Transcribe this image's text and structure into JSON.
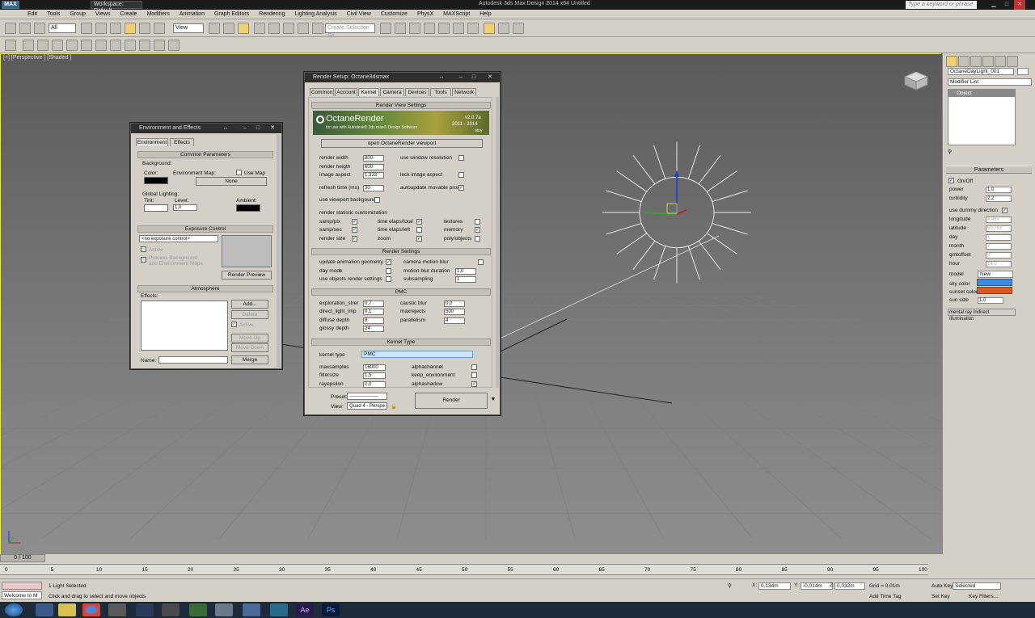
{
  "titlebar": {
    "logo": "MAX",
    "workspace": "Workspace: Default",
    "title": "Autodesk 3ds Max Design 2014 x64     Untitled",
    "search_placeholder": "Type a keyword or phrase"
  },
  "menu": [
    "Edit",
    "Tools",
    "Group",
    "Views",
    "Create",
    "Modifiers",
    "Animation",
    "Graph Editors",
    "Rendering",
    "Lighting Analysis",
    "Civil View",
    "Customize",
    "PhysX",
    "MAXScript",
    "Help"
  ],
  "toolbar": {
    "filter": "All",
    "coord": "View",
    "selection_set": "Create Selection Se"
  },
  "viewport": {
    "label": "[+] [Perspective ] [Shaded ]"
  },
  "env": {
    "title": "Environment and Effects",
    "tabs": [
      "Environment",
      "Effects"
    ],
    "common": "Common Parameters",
    "background": "Background:",
    "color": "Color:",
    "env_map": "Environment Map:",
    "use_map": "Use Map",
    "none": "None",
    "global": "Global Lighting:",
    "tint": "Tint:",
    "level": "Level:",
    "level_val": "1,0",
    "ambient": "Ambient:",
    "exposure": "Exposure Control",
    "exposure_val": "<no exposure control>",
    "active": "Active",
    "process": "Process Background\nand Environment Maps",
    "preview": "Render Preview",
    "atmos": "Atmosphere",
    "effects": "Effects:",
    "add": "Add...",
    "delete": "Delete",
    "active2": "Active",
    "move_up": "Move Up",
    "move_down": "Move Down",
    "name": "Name:",
    "merge": "Merge"
  },
  "render": {
    "title": "Render Setup: Octane3dsmax",
    "tabs": [
      "Common",
      "Account",
      "Kernel",
      "Camera",
      "Devices",
      "Tools",
      "Network"
    ],
    "sec_view": "Render View Settings",
    "banner": {
      "name": "OctaneRender",
      "sub": "for use with Autodesk® 3ds max® Design Software",
      "version": "v2.0.7a",
      "years": "2011 - 2014",
      "brand": "otoy"
    },
    "open_vp": "open OctaneRender viewport",
    "width": "render width",
    "width_val": "800",
    "height": "render heigth",
    "height_val": "600",
    "aspect": "image aspect",
    "aspect_val": "1,333",
    "use_win": "use window resolution",
    "lock_aspect": "lock image aspect",
    "refresh": "refresh time (ms)",
    "refresh_val": "30",
    "autoupdate": "autoupdate movable proxy",
    "use_bg": "use viewport backgound",
    "stats": "render statistic customization",
    "stat_items": [
      "samp/pix",
      "time elaps/total",
      "textures",
      "samp/sec",
      "time elaps/left",
      "memory",
      "render size",
      "zoom",
      "poly/objects"
    ],
    "sec_settings": "Render Settings",
    "update_geom": "update animation geometry",
    "cam_blur": "camera motion blur",
    "day_mode": "day mode",
    "blur_dur": "motion blur duration",
    "blur_dur_val": "1,0",
    "use_obj": "use objects render settings",
    "subsampling": "subsampling",
    "subsampling_val": "1",
    "sec_pmc": "PMC",
    "expl": "exploration_strer",
    "expl_val": "0,7",
    "caustic": "caustic blur",
    "caustic_val": "0,0",
    "direct": "direct_light_imp",
    "direct_val": "0,1",
    "maxrej": "maxrejects",
    "maxrej_val": "500",
    "diffuse": "diffuse depth",
    "diffuse_val": "8",
    "parallel": "parallelism",
    "parallel_val": "4",
    "glossy": "glossy depth",
    "glossy_val": "24",
    "sec_kernel": "Kernel Type",
    "ktype": "kernel type",
    "ktype_val": "PMC",
    "maxs": "maxsamples",
    "maxs_val": "16000",
    "alphach": "alphachannel",
    "filt": "filtersize",
    "filt_val": "1,5",
    "keepenv": "keep_environment",
    "ray": "rayepsilon",
    "ray_val": "0,0",
    "alphash": "alphashadow",
    "preset": "Preset:",
    "preset_val": "------------------",
    "view": "View:",
    "view_val": "Quad 4 - Perspe",
    "render_btn": "Render"
  },
  "cmdpanel": {
    "object_name": "OctaneDayLight_001",
    "modlist": "Modifier List",
    "object": "Object",
    "params": "Parameters",
    "onoff": "On/Off",
    "rows": [
      {
        "label": "power",
        "val": "1,0",
        "dis": false
      },
      {
        "label": "turbidity",
        "val": "2,2",
        "dis": false
      }
    ],
    "dummy": "use dummy direction",
    "rows2": [
      {
        "label": "longitude",
        "val": "4,467",
        "dis": true
      },
      {
        "label": "latitude",
        "val": "50,767",
        "dis": true
      },
      {
        "label": "day",
        "val": "1",
        "dis": true
      },
      {
        "label": "month",
        "val": "7",
        "dis": true
      },
      {
        "label": "gmtoffset",
        "val": "0",
        "dis": true
      },
      {
        "label": "hour",
        "val": "14,0",
        "dis": true
      }
    ],
    "model": "model",
    "model_val": "New",
    "sky": "sky color",
    "sunset": "sunset color",
    "sunsize": "sun size",
    "sunsize_val": "1,0",
    "mr": "mental ray Indirect Illumination",
    "colors": {
      "sky": "#3b8be0",
      "sunset": "#d65a22"
    }
  },
  "timeline": {
    "slider": "0 / 100",
    "ticks": [
      "0",
      "5",
      "10",
      "15",
      "20",
      "25",
      "30",
      "35",
      "40",
      "45",
      "50",
      "55",
      "60",
      "65",
      "70",
      "75",
      "80",
      "85",
      "90",
      "95",
      "100"
    ]
  },
  "status": {
    "selected": "1 Light Selected",
    "prompt": "Click and drag to select and move objects",
    "welcome": "Welcome to M",
    "x": "0,134m",
    "y": "-0,014m",
    "z": "0,032m",
    "grid": "Grid = 0,01m",
    "add_tag": "Add Time Tag",
    "auto_key": "Auto Key",
    "set_key": "Set Key",
    "selected_dd": "Selected",
    "key_filters": "Key Filters..."
  }
}
